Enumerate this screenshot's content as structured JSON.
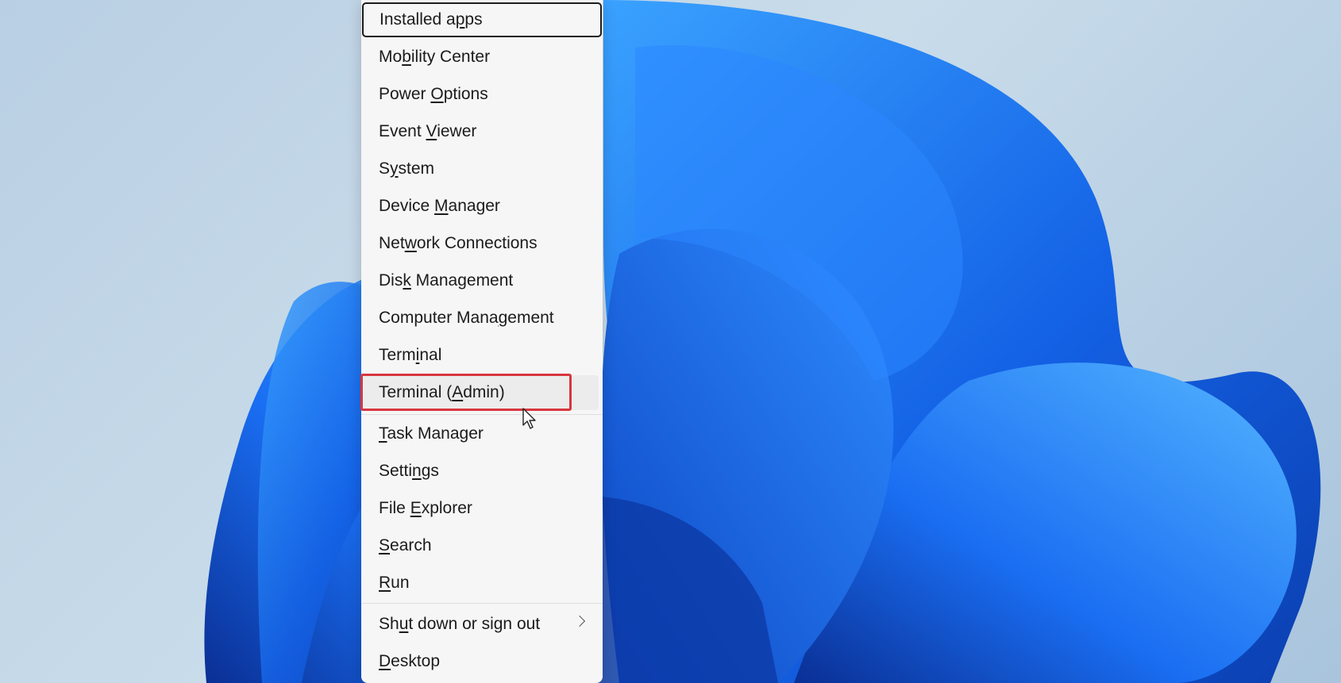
{
  "colors": {
    "menu_background": "#f6f6f6",
    "text": "#1b1b1b",
    "highlight_outline": "#d9363e",
    "wallpaper_blue": "#1f6ff0"
  },
  "menu": {
    "focused_item": "Installed apps",
    "hovered_item": "Terminal (Admin)",
    "items": [
      {
        "pre": "Installed a",
        "key": "p",
        "post": "ps"
      },
      {
        "pre": "Mo",
        "key": "b",
        "post": "ility Center"
      },
      {
        "pre": "Power ",
        "key": "O",
        "post": "ptions"
      },
      {
        "pre": "Event ",
        "key": "V",
        "post": "iewer"
      },
      {
        "pre": "S",
        "key": "y",
        "post": "stem"
      },
      {
        "pre": "Device ",
        "key": "M",
        "post": "anager"
      },
      {
        "pre": "Net",
        "key": "w",
        "post": "ork Connections"
      },
      {
        "pre": "Dis",
        "key": "k",
        "post": " Management"
      },
      {
        "pre": "Computer Mana",
        "key": "g",
        "post": "ement"
      },
      {
        "pre": "Term",
        "key": "i",
        "post": "nal"
      },
      {
        "pre": "Terminal (",
        "key": "A",
        "post": "dmin)"
      },
      {
        "pre": "",
        "key": "T",
        "post": "ask Manager"
      },
      {
        "pre": "Setti",
        "key": "n",
        "post": "gs"
      },
      {
        "pre": "File ",
        "key": "E",
        "post": "xplorer"
      },
      {
        "pre": "",
        "key": "S",
        "post": "earch"
      },
      {
        "pre": "",
        "key": "R",
        "post": "un"
      },
      {
        "pre": "Sh",
        "key": "u",
        "post": "t down or sign out"
      },
      {
        "pre": "",
        "key": "D",
        "post": "esktop"
      }
    ],
    "submenu_icon": "chevron-right-icon"
  },
  "cursor_icon": "arrow-pointer-icon"
}
